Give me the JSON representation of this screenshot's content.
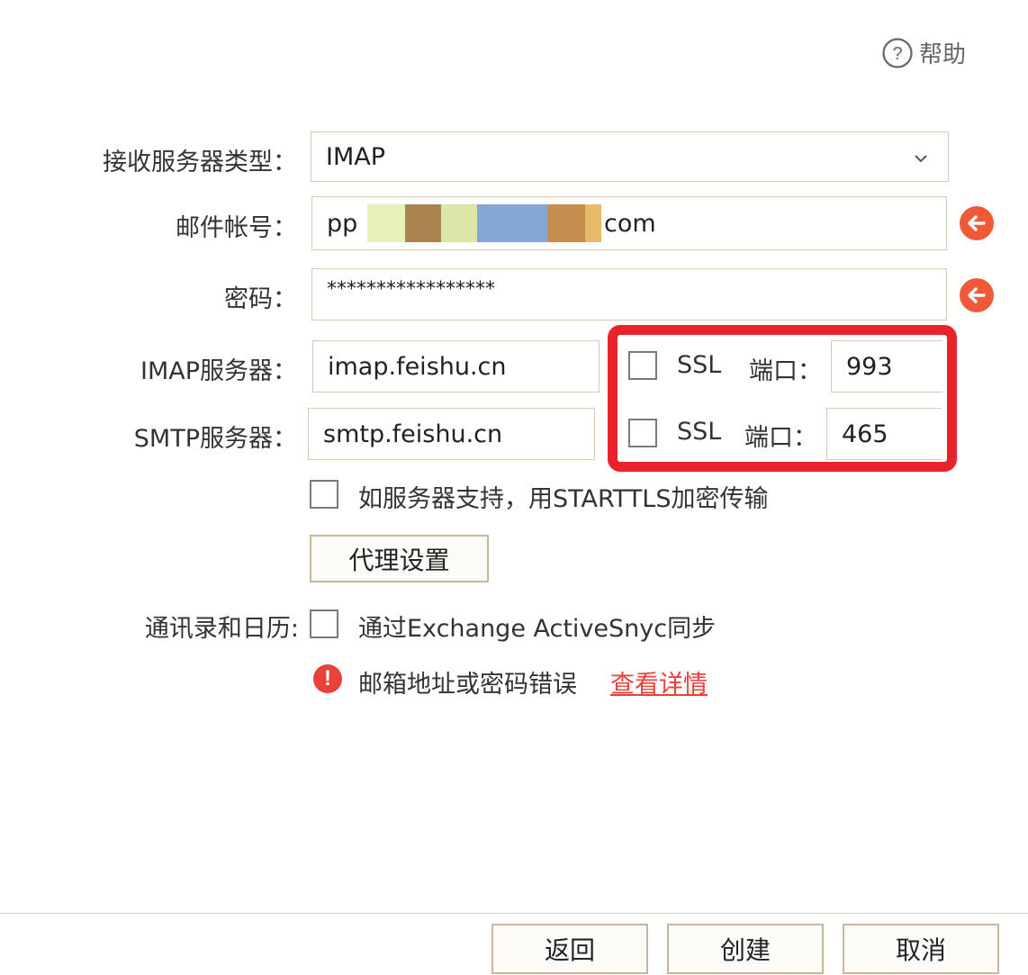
{
  "header": {
    "help_label": "帮助",
    "help_icon": "question-circle-icon"
  },
  "form": {
    "server_type": {
      "label": "接收服务器类型：",
      "value": "IMAP"
    },
    "account": {
      "label": "邮件帐号：",
      "value_prefix": "pp",
      "value_suffix": "com"
    },
    "password": {
      "label": "密码：",
      "value": "*****************"
    },
    "imap": {
      "label": "IMAP服务器：",
      "value": "imap.feishu.cn",
      "ssl_label": "SSL",
      "port_label": "端口：",
      "port": "993"
    },
    "smtp": {
      "label": "SMTP服务器：",
      "value": "smtp.feishu.cn",
      "ssl_label": "SSL",
      "port_label": "端口：",
      "port": "465"
    },
    "starttls_label": "如服务器支持，用STARTTLS加密传输",
    "proxy_button": "代理设置",
    "contacts": {
      "label": "通讯录和日历:",
      "option_label": "通过Exchange ActiveSnyc同步"
    },
    "error": {
      "message": "邮箱地址或密码错误",
      "link": "查看详情"
    }
  },
  "footer": {
    "back_button": "返回",
    "create_button": "创建",
    "cancel_button": "取消"
  },
  "colors": {
    "accent": "#f05a38",
    "highlight_box": "#e8232c",
    "border": "#dcc9ad",
    "error": "#e8413a"
  }
}
